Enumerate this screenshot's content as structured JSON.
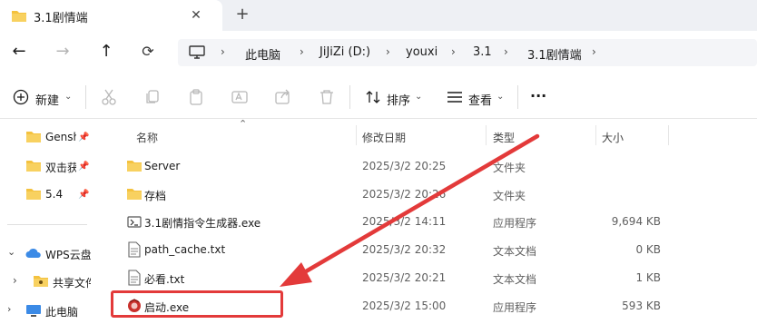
{
  "tab": {
    "title": "3.1剧情端",
    "close": "✕",
    "new": "+"
  },
  "nav": {
    "back": "←",
    "forward": "→",
    "up": "↑"
  },
  "breadcrumb": [
    "此电脑",
    "JiJiZi (D:)",
    "youxi",
    "3.1",
    "3.1剧情端"
  ],
  "toolbar": {
    "new_label": "新建",
    "sort_label": "排序",
    "view_label": "查看",
    "more": "···"
  },
  "sidebar": {
    "pinned": [
      {
        "label": "Gensh"
      },
      {
        "label": "双击获"
      },
      {
        "label": "5.4"
      }
    ],
    "wps": "WPS云盘",
    "shared": "共享文件",
    "pc": "此电脑"
  },
  "columns": {
    "name": "名称",
    "date": "修改日期",
    "type": "类型",
    "size": "大小"
  },
  "files": [
    {
      "name": "Server",
      "date": "2025/3/2 20:25",
      "type": "文件夹",
      "size": "",
      "icon": "folder-icon"
    },
    {
      "name": "存档",
      "date": "2025/3/2 20:26",
      "type": "文件夹",
      "size": "",
      "icon": "folder-icon"
    },
    {
      "name": "3.1剧情指令生成器.exe",
      "date": "2025/3/2 14:11",
      "type": "应用程序",
      "size": "9,694 KB",
      "icon": "exe-icon"
    },
    {
      "name": "path_cache.txt",
      "date": "2025/3/2 20:32",
      "type": "文本文档",
      "size": "0 KB",
      "icon": "text-file-icon"
    },
    {
      "name": "必看.txt",
      "date": "2025/3/2 20:21",
      "type": "文本文档",
      "size": "1 KB",
      "icon": "text-file-icon"
    },
    {
      "name": "启动.exe",
      "date": "2025/3/2 15:00",
      "type": "应用程序",
      "size": "593 KB",
      "icon": "app-icon"
    }
  ],
  "colors": {
    "annotation": "#e33a3a",
    "folder": "#f4c23f",
    "accent": "#0067c0"
  }
}
